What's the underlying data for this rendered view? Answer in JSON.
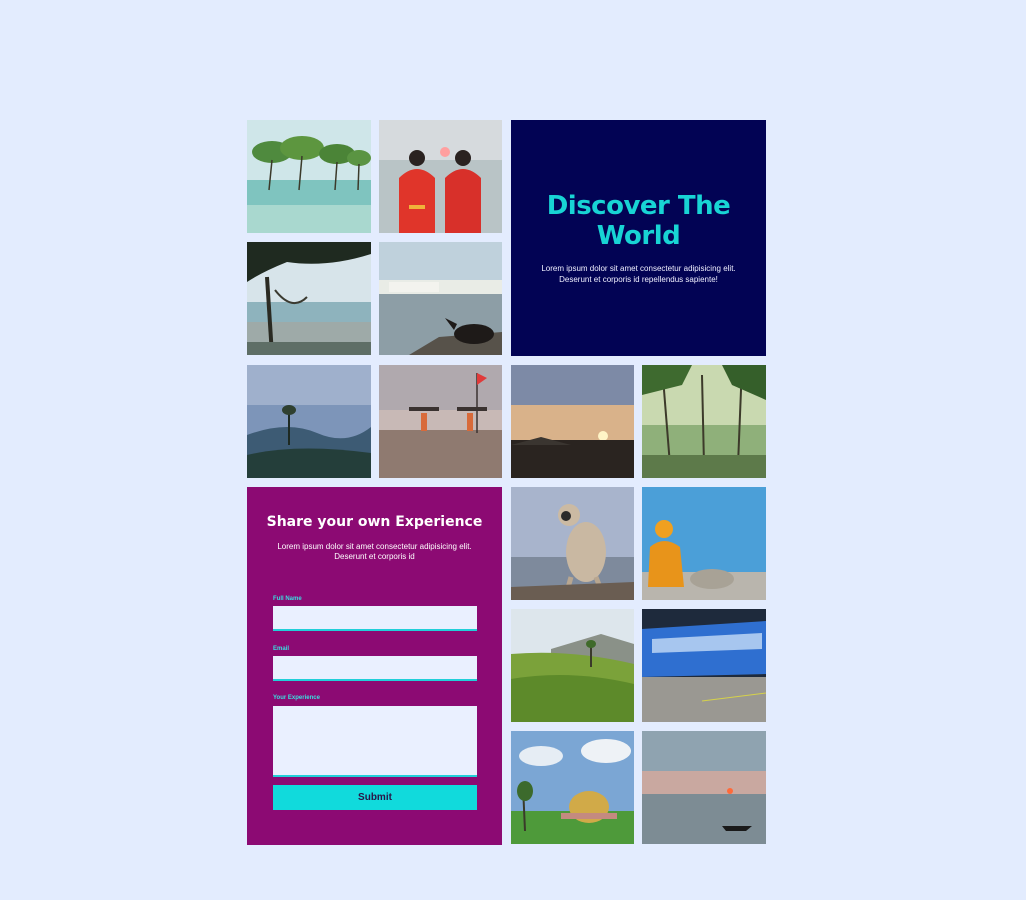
{
  "hero": {
    "title": "Discover The World",
    "text": "Lorem ipsum dolor sit amet consectetur adipisicing elit. Deserunt et corporis id repellendus sapiente!"
  },
  "form": {
    "title": "Share your own Experience",
    "text": "Lorem ipsum dolor sit amet consectetur adipisicing elit. Deserunt et corporis id",
    "name_label": "Full Name",
    "email_label": "Email",
    "experience_label": "Your Experience",
    "name_value": "",
    "email_value": "",
    "experience_value": "",
    "submit_label": "Submit"
  },
  "colors": {
    "background": "#e3ecfe",
    "hero_bg": "#020354",
    "hero_title": "#18d4d4",
    "form_bg": "#8c0a73",
    "accent": "#11dadc"
  },
  "photos": [
    "mangrove-trees-in-sea",
    "two-people-in-red-facing-sunrise",
    "hammock-on-beach",
    "cow-by-lake-with-white-buildings",
    "misty-blue-hills",
    "people-carrying-boat-on-beach-with-red-flag",
    "sunset-over-plain",
    "sunlit-palm-grove",
    "langur-monkey-on-rock",
    "sadhu-against-blue-wall",
    "tea-plantation-hills",
    "blurred-blue-train",
    "golden-dome-building",
    "boat-on-lake-at-dusk"
  ]
}
